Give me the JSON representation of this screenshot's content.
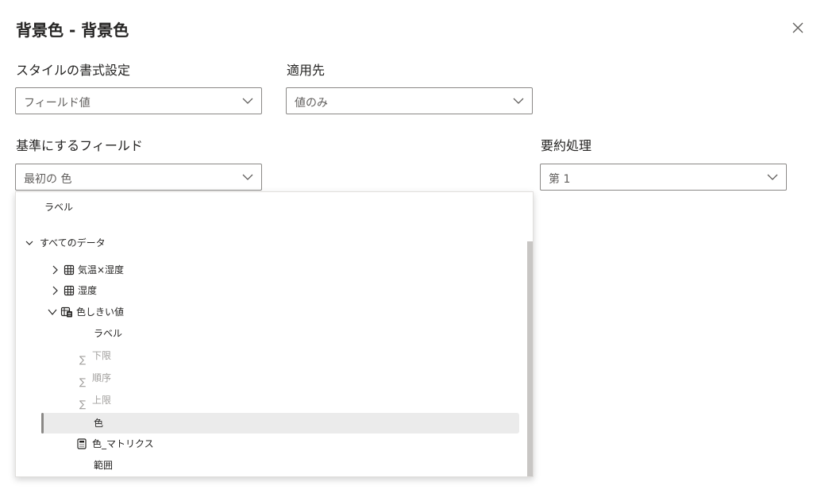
{
  "dialog": {
    "title": "背景色 - 背景色"
  },
  "format_style": {
    "label": "スタイルの書式設定",
    "value": "フィールド値"
  },
  "apply_to": {
    "label": "適用先",
    "value": "値のみ"
  },
  "based_on_field": {
    "label": "基準にするフィールド",
    "value": "最初の 色"
  },
  "summarization": {
    "label": "要約処理",
    "value": "第 1"
  },
  "field_list": {
    "section_label": "ラベル",
    "all_data": "すべてのデータ",
    "tables": [
      {
        "name": "気温×湿度",
        "icon": "table-icon",
        "expanded": false
      },
      {
        "name": "湿度",
        "icon": "table-icon",
        "expanded": false
      },
      {
        "name": "色しきい値",
        "icon": "table-calc-icon",
        "expanded": true
      }
    ],
    "fields": [
      {
        "name": "ラベル",
        "icon": "",
        "disabled": false
      },
      {
        "name": "下限",
        "icon": "sigma-icon",
        "disabled": true
      },
      {
        "name": "順序",
        "icon": "sigma-icon",
        "disabled": true
      },
      {
        "name": "上限",
        "icon": "sigma-icon",
        "disabled": true
      },
      {
        "name": "色",
        "icon": "",
        "disabled": false,
        "selected": true
      },
      {
        "name": "色_マトリクス",
        "icon": "calculator-icon",
        "disabled": false
      },
      {
        "name": "範囲",
        "icon": "",
        "disabled": false
      }
    ]
  },
  "colors": {
    "text": "#252423",
    "border": "#8a8886",
    "disabled": "#a19f9d",
    "selected_bg": "#ebebeb"
  }
}
